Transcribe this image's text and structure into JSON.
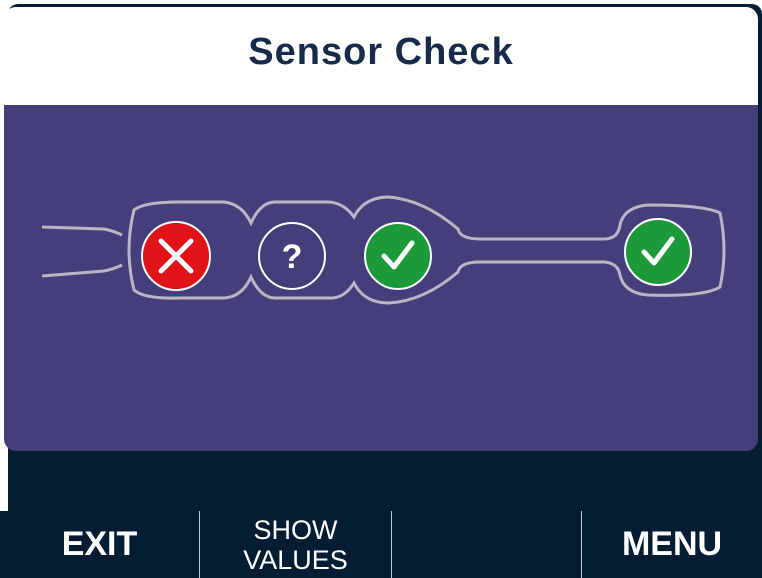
{
  "header": {
    "title": "Sensor Check"
  },
  "sensors": [
    {
      "status": "fail",
      "icon": "x-icon",
      "color": "#e0131a"
    },
    {
      "status": "unknown",
      "icon": "question-icon",
      "symbol": "?",
      "color": "#443e7a"
    },
    {
      "status": "ok",
      "icon": "check-icon",
      "color": "#1c9a3a"
    },
    {
      "status": "ok",
      "icon": "check-icon",
      "color": "#1c9a3a"
    }
  ],
  "softkeys": {
    "exit": "EXIT",
    "show_values_line1": "SHOW",
    "show_values_line2": "VALUES",
    "empty": "",
    "menu": "MENU"
  },
  "colors": {
    "background": "#041d33",
    "panel": "#443e7a",
    "outline": "#b9b5c4",
    "fail": "#e0131a",
    "ok": "#1c9a3a"
  }
}
